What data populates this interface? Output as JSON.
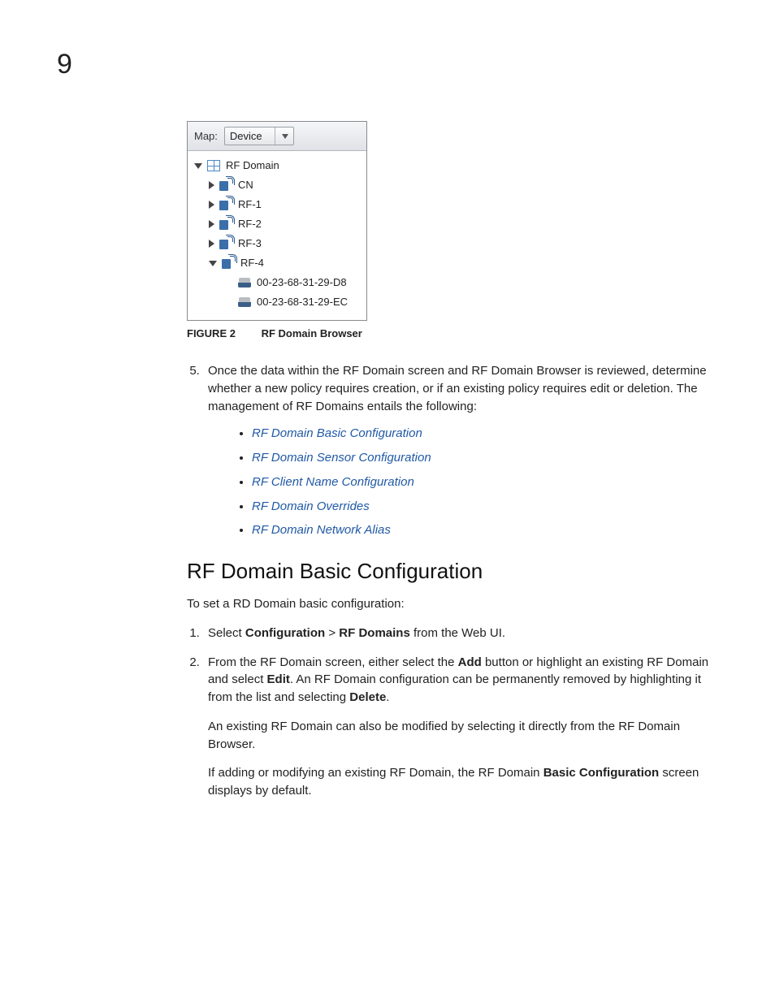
{
  "chapter": "9",
  "browser": {
    "map_label": "Map:",
    "select_value": "Device",
    "root": "RF Domain",
    "items": [
      "CN",
      "RF-1",
      "RF-2",
      "RF-3",
      "RF-4"
    ],
    "leaf_devices": [
      "00-23-68-31-29-D8",
      "00-23-68-31-29-EC"
    ]
  },
  "figure": {
    "label": "FIGURE 2",
    "caption": "RF Domain Browser"
  },
  "step5": {
    "num": "5.",
    "text": "Once the data within the RF Domain screen and RF Domain Browser is reviewed, determine whether a new policy requires creation, or if an existing policy requires edit or deletion. The management of RF Domains entails the following:"
  },
  "links": [
    "RF Domain Basic Configuration",
    "RF Domain Sensor Configuration",
    "RF Client Name Configuration",
    "RF Domain Overrides",
    "RF Domain Network Alias"
  ],
  "section_heading": "RF Domain Basic Configuration",
  "intro": "To set a RD Domain basic configuration:",
  "steps": {
    "s1": {
      "pre": "Select ",
      "b1": "Configuration",
      "mid": " > ",
      "b2": "RF Domains",
      "post": " from the Web UI."
    },
    "s2": {
      "p1_pre": "From the RF Domain screen, either select the ",
      "p1_b1": "Add",
      "p1_mid1": " button or highlight an existing RF Domain and select ",
      "p1_b2": "Edit",
      "p1_mid2": ". An RF Domain configuration can be permanently removed by highlighting it from the list and selecting ",
      "p1_b3": "Delete",
      "p1_end": ".",
      "p2": "An existing RF Domain can also be modified by selecting it directly from the RF Domain Browser.",
      "p3_pre": "If adding or modifying an existing RF Domain, the RF Domain ",
      "p3_b": "Basic Configuration",
      "p3_post": " screen displays by default."
    }
  }
}
